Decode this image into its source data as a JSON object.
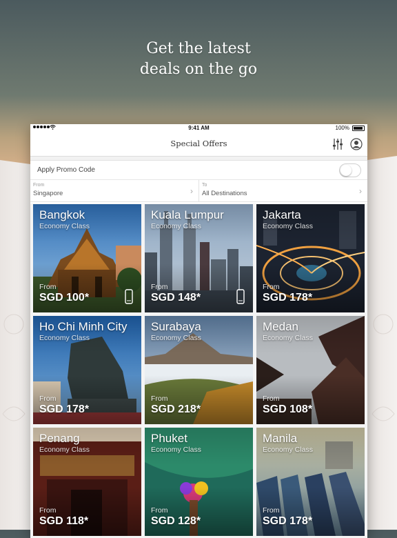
{
  "headline": {
    "line1": "Get the latest",
    "line2": "deals on the go"
  },
  "statusbar": {
    "time": "9:41 AM",
    "battery": "100%"
  },
  "navbar": {
    "title": "Special Offers"
  },
  "promo": {
    "label": "Apply Promo Code",
    "enabled": false
  },
  "route": {
    "from_label": "From",
    "from_value": "Singapore",
    "to_label": "To",
    "to_value": "All Destinations"
  },
  "offers": [
    {
      "city": "Bangkok",
      "class": "Economy Class",
      "from": "From",
      "price": "SGD 100*",
      "mobile_only": true
    },
    {
      "city": "Kuala Lumpur",
      "class": "Economy Class",
      "from": "From",
      "price": "SGD 148*",
      "mobile_only": true
    },
    {
      "city": "Jakarta",
      "class": "Economy Class",
      "from": "From",
      "price": "SGD 178*",
      "mobile_only": false
    },
    {
      "city": "Ho Chi Minh City",
      "class": "Economy Class",
      "from": "From",
      "price": "SGD 178*",
      "mobile_only": false
    },
    {
      "city": "Surabaya",
      "class": "Economy Class",
      "from": "From",
      "price": "SGD 218*",
      "mobile_only": false
    },
    {
      "city": "Medan",
      "class": "Economy Class",
      "from": "From",
      "price": "SGD 108*",
      "mobile_only": false
    },
    {
      "city": "Penang",
      "class": "Economy Class",
      "from": "From",
      "price": "SGD 118*",
      "mobile_only": false
    },
    {
      "city": "Phuket",
      "class": "Economy Class",
      "from": "From",
      "price": "SGD 128*",
      "mobile_only": false
    },
    {
      "city": "Manila",
      "class": "Economy Class",
      "from": "From",
      "price": "SGD 178*",
      "mobile_only": false
    }
  ]
}
